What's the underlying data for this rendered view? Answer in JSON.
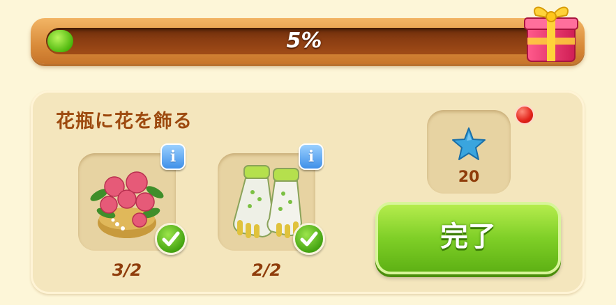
{
  "progress": {
    "value_percent": 5,
    "label": "5%"
  },
  "task": {
    "title": "花瓶に花を飾る",
    "items": [
      {
        "icon": "flower-pot-icon",
        "count": "3/2",
        "completed": true
      },
      {
        "icon": "garden-gloves-icon",
        "count": "2/2",
        "completed": true
      }
    ],
    "reward": {
      "icon": "blue-star-icon",
      "amount": "20"
    },
    "complete_label": "完了"
  },
  "colors": {
    "title": "#9d4a0f",
    "button": "#7fcf27",
    "bar_fill": "#4fb80e"
  }
}
